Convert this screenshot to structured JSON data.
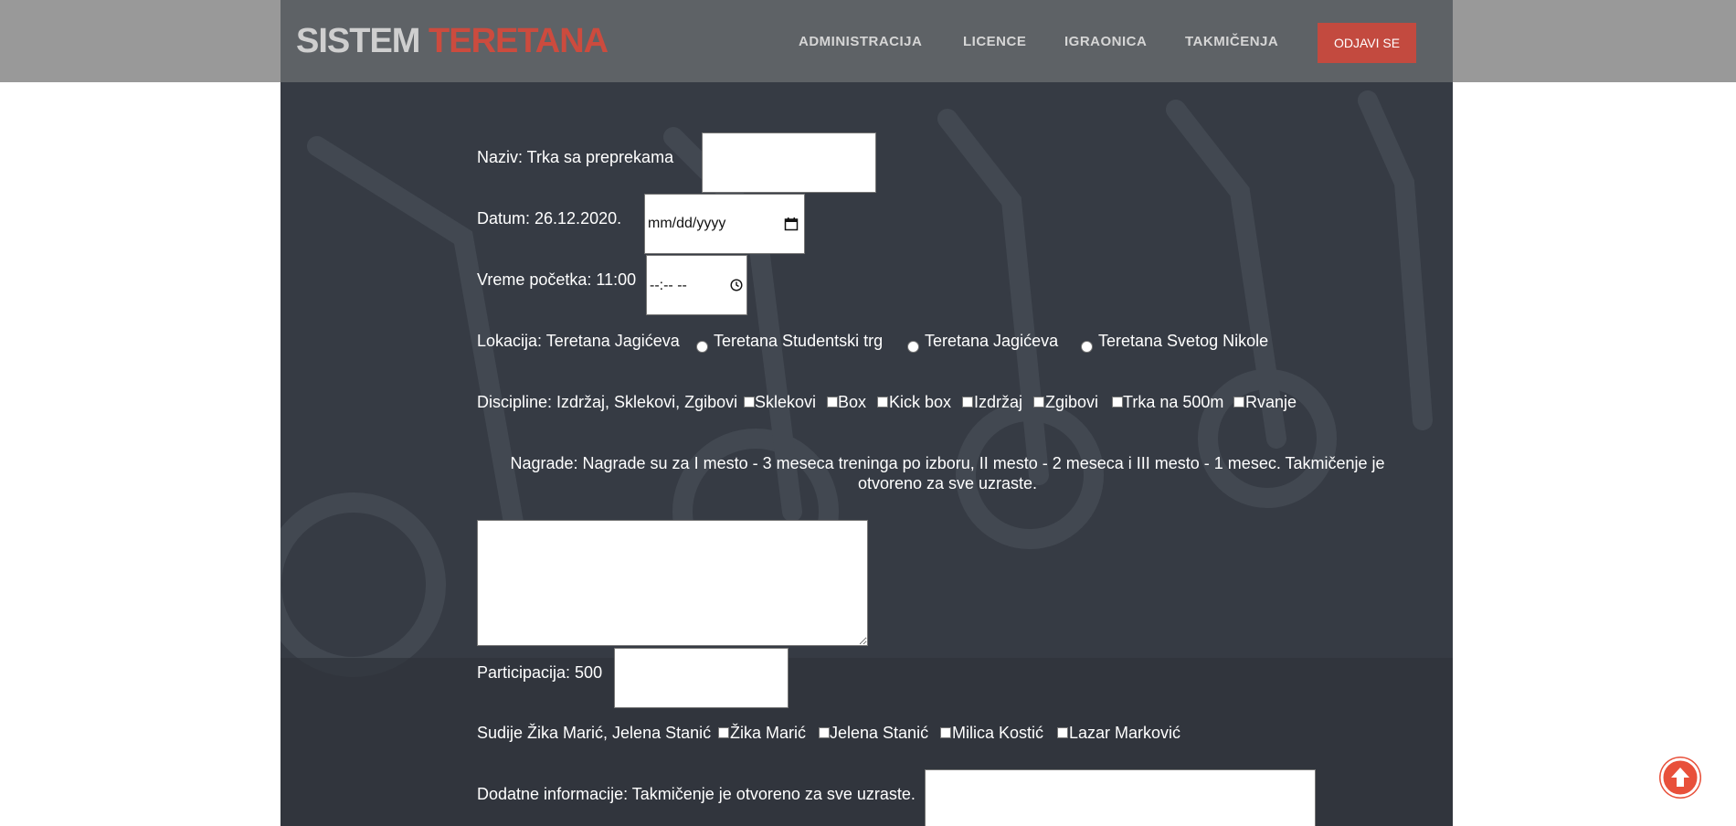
{
  "brand": {
    "part1": "SISTEM",
    "part2": "TERETANA"
  },
  "nav": {
    "items": [
      "ADMINISTRACIJA",
      "LICENCE",
      "IGRAONICA",
      "TAKMIČENJA"
    ],
    "logout": "ODJAVI SE"
  },
  "form": {
    "naziv_label": "Naziv: Trka sa preprekama",
    "datum_label": "Datum: 26.12.2020.",
    "datum_placeholder": "mm/dd/yyyy",
    "vreme_label": "Vreme početka: 11:00",
    "vreme_placeholder": "--:-- --",
    "lokacija_label": "Lokacija: Teretana Jagićeva",
    "lokacija_options": [
      "Teretana Studentski trg",
      "Teretana Jagićeva",
      "Teretana Svetog Nikole"
    ],
    "discipline_label": "Discipline: Izdržaj, Sklekovi, Zgibovi",
    "discipline_options": [
      "Sklekovi",
      "Box",
      "Kick box",
      "Izdržaj",
      "Zgibovi",
      "Trka na 500m",
      "Rvanje"
    ],
    "nagrade_text": "Nagrade: Nagrade su za I mesto - 3 meseca treninga po izboru, II mesto - 2 meseca i III mesto - 1 mesec. Takmičenje je otvoreno za sve uzraste.",
    "participacija_label": "Participacija: 500",
    "sudije_label": "Sudije Žika Marić, Jelena Stanić",
    "sudije_options": [
      "Žika Marić",
      "Jelena Stanić",
      "Milica Kostić",
      "Lazar Marković"
    ],
    "dodatne_label": "Dodatne informacije: Takmičenje je otvoreno za sve uzraste."
  },
  "colors": {
    "accent": "#cc4b3e",
    "panel": "#363b44",
    "header": "#5e6266",
    "topbar": "#999999",
    "scroll_button": "#e8503a"
  },
  "icons": [
    "calendar-icon",
    "clock-icon",
    "arrow-up-icon"
  ]
}
